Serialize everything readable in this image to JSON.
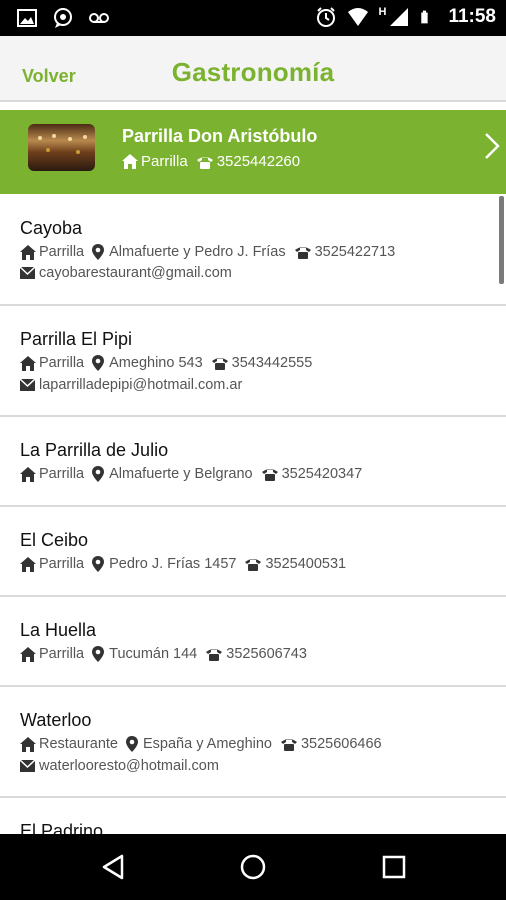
{
  "status_bar": {
    "time": "11:58",
    "left_icons": [
      "image-icon",
      "chat-icon",
      "voicemail-icon"
    ],
    "right_icons": [
      "alarm-icon",
      "wifi-icon",
      "signal-icon",
      "battery-icon"
    ],
    "network_letter": "H"
  },
  "header": {
    "back_label": "Volver",
    "title": "Gastronomía",
    "accent_color": "#7bb22f"
  },
  "featured": {
    "name": "Parrilla Don Aristóbulo",
    "category": "Parrilla",
    "phone": "3525442260"
  },
  "items": [
    {
      "name": "Cayoba",
      "category": "Parrilla",
      "address": "Almafuerte y Pedro J. Frías",
      "phone": "3525422713",
      "email": "cayobarestaurant@gmail.com"
    },
    {
      "name": "Parrilla El Pipi",
      "category": "Parrilla",
      "address": "Ameghino 543",
      "phone": "3543442555",
      "email": "laparrilladepipi@hotmail.com.ar"
    },
    {
      "name": "La Parrilla de Julio",
      "category": "Parrilla",
      "address": "Almafuerte y Belgrano",
      "phone": "3525420347"
    },
    {
      "name": "El Ceibo",
      "category": "Parrilla",
      "address": "Pedro J. Frías 1457",
      "phone": "3525400531"
    },
    {
      "name": "La Huella",
      "category": "Parrilla",
      "address": "Tucumán 144",
      "phone": "3525606743"
    },
    {
      "name": "Waterloo",
      "category": "Restaurante",
      "address": "España y Ameghino",
      "phone": "3525606466",
      "email": "waterlooresto@hotmail.com"
    },
    {
      "name": "El Padrino"
    }
  ],
  "nav_bar": {
    "buttons": [
      "back-icon",
      "home-icon",
      "recents-icon"
    ]
  }
}
